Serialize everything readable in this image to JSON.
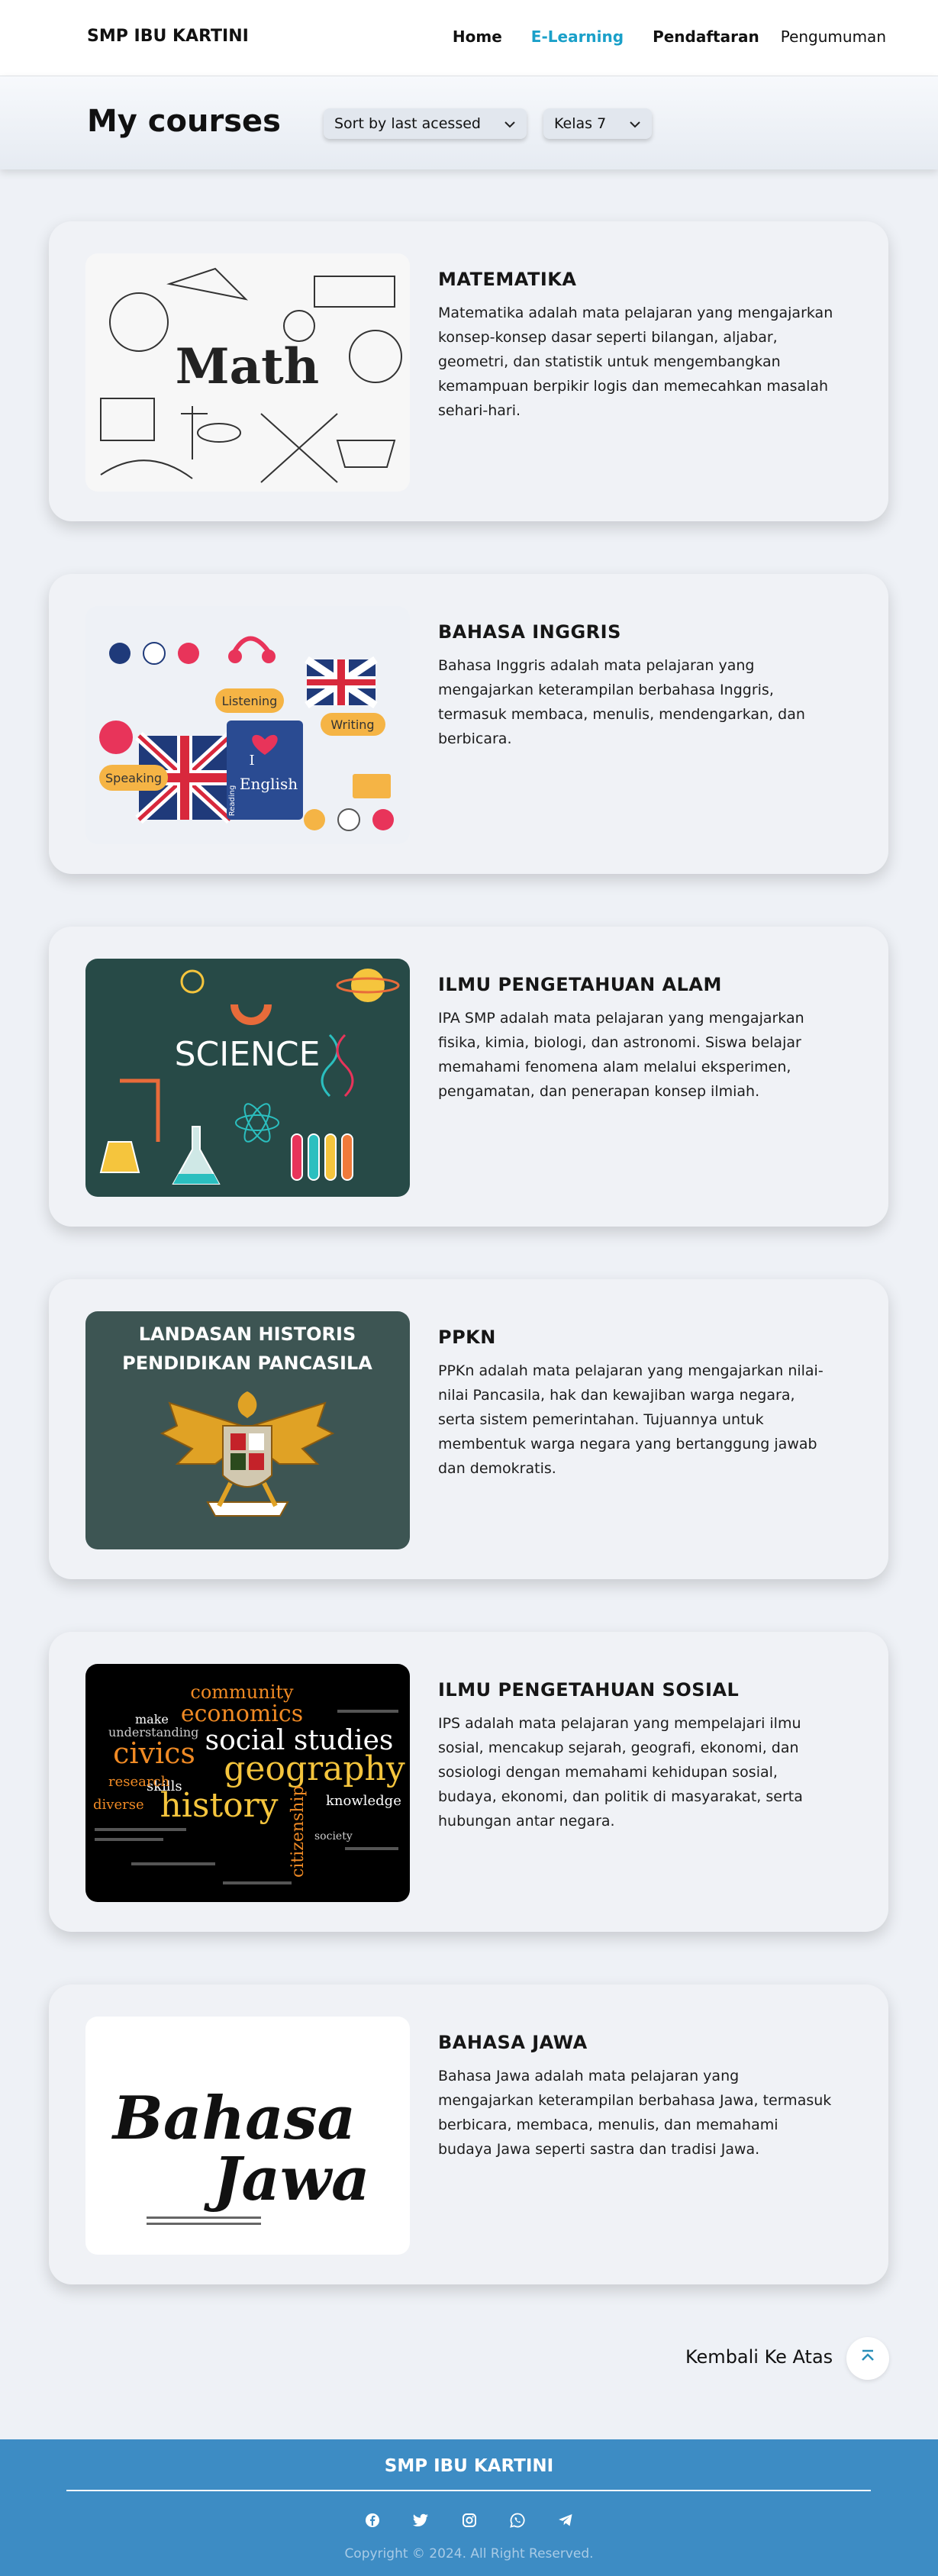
{
  "nav": {
    "brand": "SMP IBU KARTINI",
    "links": [
      {
        "label": "Home"
      },
      {
        "label": "E-Learning"
      },
      {
        "label": "Pendaftaran"
      },
      {
        "label": "Pengumuman"
      }
    ],
    "active_color": "#1aa0c9"
  },
  "header": {
    "title": "My courses",
    "sort_select": "Sort by last acessed",
    "class_select": "Kelas 7"
  },
  "courses": [
    {
      "title": "MATEMATIKA",
      "description": "Matematika adalah mata pelajaran yang mengajarkan konsep-konsep dasar seperti bilangan, aljabar, geometri, dan statistik untuk mengembangkan kemampuan berpikir logis dan memecahkan masalah sehari-hari.",
      "image_text": "Math"
    },
    {
      "title": "BAHASA INGGRIS",
      "description": "Bahasa Inggris adalah mata pelajaran yang mengajarkan keterampilan berbahasa Inggris, termasuk membaca, menulis, mendengarkan, dan berbicara.",
      "image_labels": [
        "Listening",
        "Writing",
        "Speaking",
        "I",
        "English",
        "Reading"
      ]
    },
    {
      "title": "ILMU PENGETAHUAN ALAM",
      "description": "IPA SMP adalah mata pelajaran yang mengajarkan fisika, kimia, biologi, dan astronomi. Siswa belajar memahami fenomena alam melalui eksperimen, pengamatan, dan penerapan konsep ilmiah.",
      "image_text": "SCIENCE"
    },
    {
      "title": "PPKN",
      "description": "PPKn adalah mata pelajaran yang mengajarkan nilai-nilai Pancasila, hak dan kewajiban warga negara, serta sistem pemerintahan. Tujuannya untuk membentuk warga negara yang bertanggung jawab dan demokratis.",
      "image_lines": [
        "LANDASAN HISTORIS",
        "PENDIDIKAN PANCASILA"
      ]
    },
    {
      "title": "ILMU PENGETAHUAN SOSIAL",
      "description": "IPS adalah mata pelajaran yang mempelajari ilmu sosial, mencakup sejarah, geografi, ekonomi, dan sosiologi dengan memahami kehidupan sosial, budaya, ekonomi, dan politik di masyarakat, serta hubungan antar negara.",
      "image_words": [
        "community",
        "economics",
        "social studies",
        "civics",
        "geography",
        "history",
        "skills",
        "citizenship",
        "knowledge",
        "research",
        "understanding",
        "diverse",
        "make",
        "society"
      ]
    },
    {
      "title": "BAHASA JAWA",
      "description": "Bahasa Jawa adalah mata pelajaran yang mengajarkan keterampilan berbahasa Jawa, termasuk berbicara, membaca, menulis, dan memahami budaya Jawa seperti sastra dan tradisi Jawa.",
      "image_lines": [
        "Bahasa",
        "Jawa"
      ]
    }
  ],
  "back_to_top": {
    "label": "Kembali Ke Atas",
    "icon": "chevron-up-double-icon"
  },
  "footer": {
    "brand": "SMP IBU KARTINI",
    "social_icons": [
      "facebook-icon",
      "twitter-icon",
      "instagram-icon",
      "whatsapp-icon",
      "telegram-icon"
    ],
    "copyright": "Copyright © 2024. All Right Reserved.",
    "background": "#3d8cc4"
  }
}
